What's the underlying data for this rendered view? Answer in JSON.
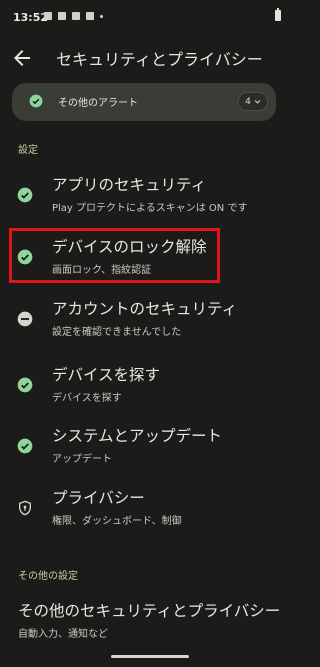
{
  "status_bar": {
    "time": "13:52"
  },
  "header": {
    "title": "セキュリティとプライバシー"
  },
  "alert_card": {
    "label": "その他のアラート",
    "count": "4"
  },
  "settings": {
    "section_title": "設定",
    "items": [
      {
        "title": "アプリのセキュリティ",
        "subtitle": "Play プロテクトによるスキャンは ON です",
        "icon": "check-circle-icon"
      },
      {
        "title": "デバイスのロック解除",
        "subtitle": "画面ロック、指紋認証",
        "icon": "check-circle-icon"
      },
      {
        "title": "アカウントのセキュリティ",
        "subtitle": "設定を確認できませんでした",
        "icon": "minus-circle-icon"
      },
      {
        "title": "デバイスを探す",
        "subtitle": "デバイスを探す",
        "icon": "check-circle-icon"
      },
      {
        "title": "システムとアップデート",
        "subtitle": "アップデート",
        "icon": "check-circle-icon"
      },
      {
        "title": "プライバシー",
        "subtitle": "権限、ダッシュボード、制御",
        "icon": "shield-icon"
      }
    ]
  },
  "other_settings": {
    "section_title": "その他の設定",
    "items": [
      {
        "title": "その他のセキュリティとプライバシー",
        "subtitle": "自動入力、通知など"
      }
    ]
  },
  "colors": {
    "background": "#1b1c19",
    "check_green": "#8fd49a",
    "highlight_red": "#e0141f",
    "section_header": "#c4cca6"
  }
}
